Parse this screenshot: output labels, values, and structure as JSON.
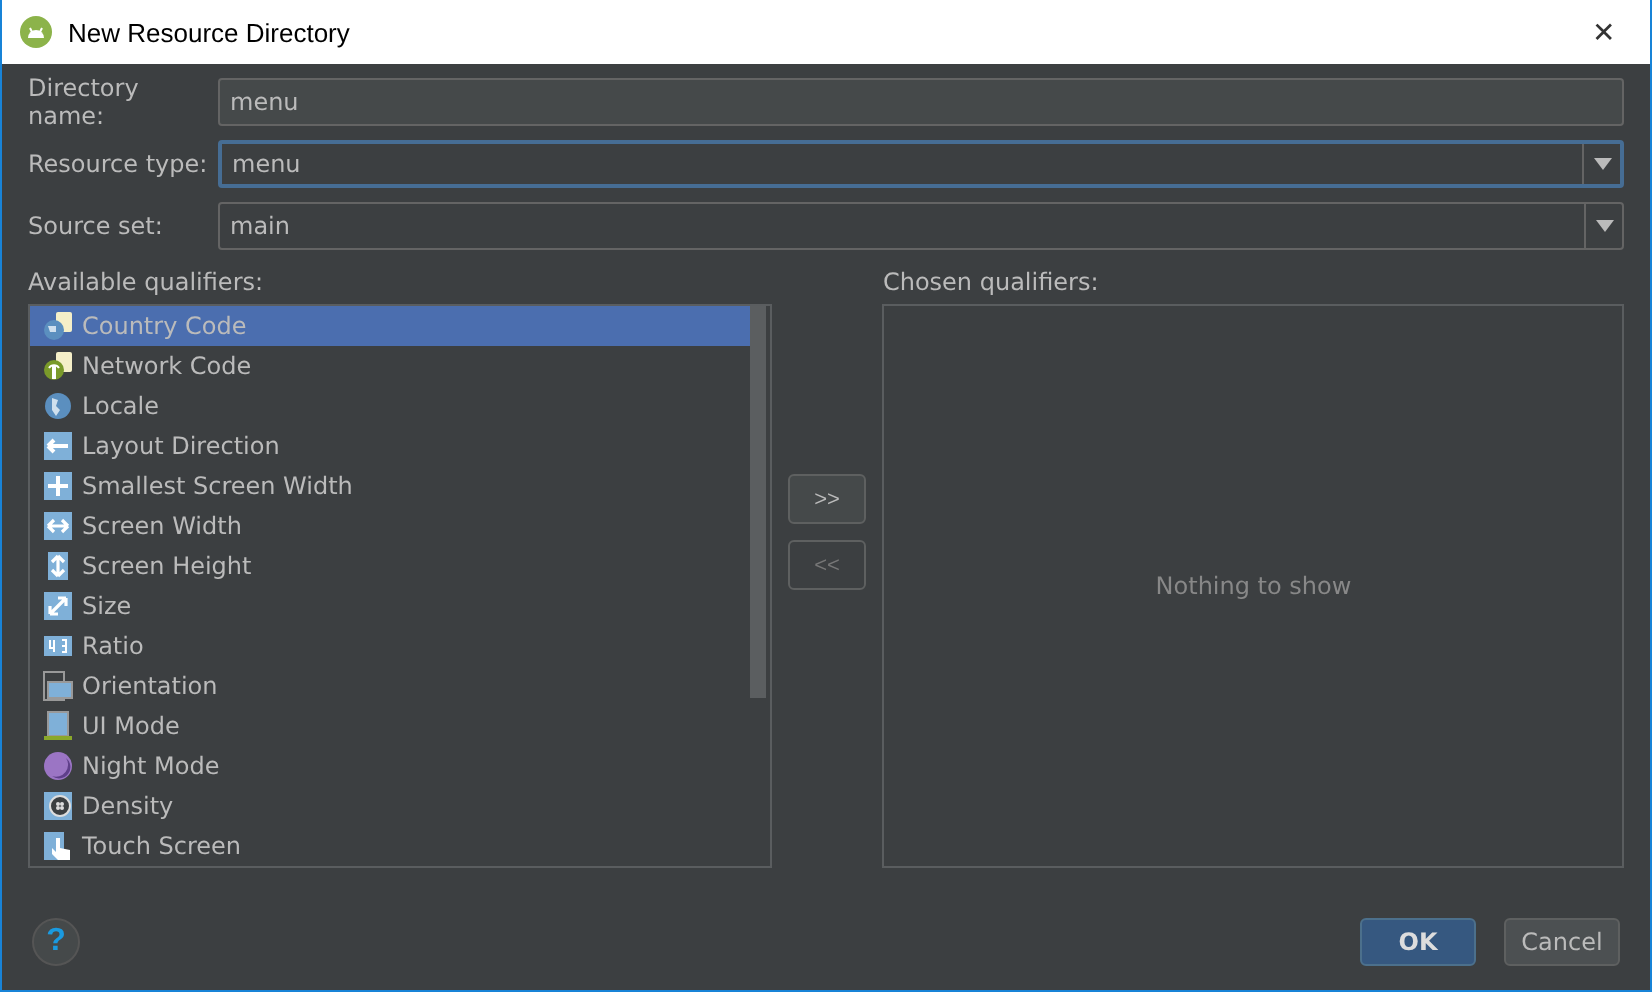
{
  "window": {
    "title": "New Resource Directory",
    "close": "✕"
  },
  "fields": [
    {
      "label": "Directory name:",
      "kind": "text",
      "value": "menu",
      "focused": false
    },
    {
      "label": "Resource type:",
      "kind": "dropdown",
      "value": "menu",
      "focused": true
    },
    {
      "label": "Source set:",
      "kind": "dropdown",
      "value": "main",
      "focused": false
    }
  ],
  "available": {
    "label": "Available qualifiers:",
    "items": [
      {
        "label": "Country Code",
        "selected": true
      },
      {
        "label": "Network Code",
        "selected": false
      },
      {
        "label": "Locale",
        "selected": false
      },
      {
        "label": "Layout Direction",
        "selected": false
      },
      {
        "label": "Smallest Screen Width",
        "selected": false
      },
      {
        "label": "Screen Width",
        "selected": false
      },
      {
        "label": "Screen Height",
        "selected": false
      },
      {
        "label": "Size",
        "selected": false
      },
      {
        "label": "Ratio",
        "selected": false
      },
      {
        "label": "Orientation",
        "selected": false
      },
      {
        "label": "UI Mode",
        "selected": false
      },
      {
        "label": "Night Mode",
        "selected": false
      },
      {
        "label": "Density",
        "selected": false
      },
      {
        "label": "Touch Screen",
        "selected": false
      }
    ]
  },
  "transfer_buttons": [
    {
      "label": ">>",
      "disabled": false
    },
    {
      "label": "<<",
      "disabled": true
    }
  ],
  "chosen": {
    "label": "Chosen qualifiers:",
    "empty_text": "Nothing to show"
  },
  "help": "?",
  "buttons": [
    {
      "label": "OK",
      "default": true
    },
    {
      "label": "Cancel",
      "default": false
    }
  ]
}
